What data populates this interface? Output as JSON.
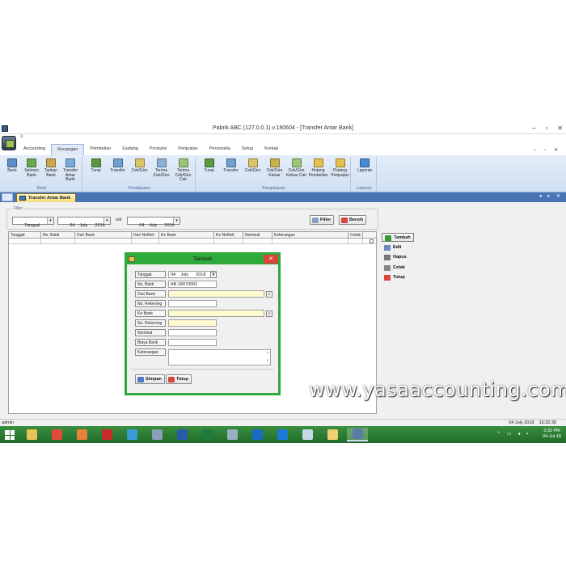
{
  "window": {
    "title": "Pabrik ABC (127.0.0.1) v.180604 - [Transfer Antar  Bank]",
    "min": "–",
    "max": "▫",
    "close": "✕"
  },
  "ribbon": {
    "qat": "≡",
    "tabs": [
      "Accounting",
      "Keuangan",
      "Pembelian",
      "Gudang",
      "Produksi",
      "Penjualan",
      "Personalia",
      "Setup",
      "Kontak"
    ],
    "active_tab": "Keuangan",
    "mini_controls": "– ▫ ✕",
    "groups": [
      {
        "name": "Bank",
        "buttons": [
          {
            "label": "Bank",
            "icon": "bank-icon",
            "color": "#5c8fc9"
          },
          {
            "label": "Setoran Bank",
            "icon": "deposit-icon",
            "color": "#6aa84f"
          },
          {
            "label": "Tarikan Bank",
            "icon": "withdraw-icon",
            "color": "#c9a94b"
          },
          {
            "label": "Transfer Antar Bank",
            "icon": "transfer-icon",
            "color": "#7aa8d8"
          }
        ]
      },
      {
        "name": "Pendapatan",
        "buttons": [
          {
            "label": "Tunai",
            "icon": "cash-icon",
            "color": "#5a9a40"
          },
          {
            "label": "Transfer",
            "icon": "transfer-income-icon",
            "color": "#6fa0d0"
          },
          {
            "label": "Cek/Giro",
            "icon": "cheque-icon",
            "color": "#d9c46a"
          },
          {
            "label": "Terima Cek/Giro",
            "icon": "receive-cheque-icon",
            "color": "#8ab0d8"
          },
          {
            "label": "Terima Cek/Giro Cair",
            "icon": "cheque-cleared-icon",
            "color": "#9bc37a"
          }
        ]
      },
      {
        "name": "Pengeluaran",
        "buttons": [
          {
            "label": "Tunai",
            "icon": "cash-out-icon",
            "color": "#5a9a40"
          },
          {
            "label": "Transfer",
            "icon": "transfer-out-icon",
            "color": "#6fa0d0"
          },
          {
            "label": "Cek/Giro",
            "icon": "cheque-out-icon",
            "color": "#d9c46a"
          },
          {
            "label": "Cek/Giro Keluar",
            "icon": "cheque-issued-icon",
            "color": "#c8b24a"
          },
          {
            "label": "Cek/Giro Keluar Cair",
            "icon": "cheque-issued-cleared-icon",
            "color": "#9bc37a"
          },
          {
            "label": "Hutang Pembelian",
            "icon": "payable-icon",
            "color": "#e6c04a"
          },
          {
            "label": "Piutang Penjualan",
            "icon": "receivable-icon",
            "color": "#e6c04a"
          }
        ]
      },
      {
        "name": "Laporan",
        "buttons": [
          {
            "label": "Laporan",
            "icon": "report-icon",
            "color": "#4a8ad0"
          }
        ]
      }
    ]
  },
  "doc_tab": {
    "label": "Transfer Antar  Bank"
  },
  "doc_controls": "◂ ▸ ✕",
  "filter": {
    "legend": "Filter",
    "field": "Tanggal",
    "date_from": "04    July      2018",
    "sd": "s/d",
    "date_to": "04    July      2018",
    "filter_btn": "Filter",
    "bersih_btn": "Bersih"
  },
  "grid": {
    "columns": [
      "Tanggal",
      "No. Bukti",
      "Dari Bank",
      "Dari NoRek",
      "Ke Bank",
      "Ke NoRek",
      "Nominal",
      "Keterangan",
      "Cetak"
    ]
  },
  "side_buttons": [
    {
      "label": "Tambah",
      "icon": "add-icon",
      "color": "#3a9a3a"
    },
    {
      "label": "Edit",
      "icon": "edit-icon",
      "color": "#6a8ac0"
    },
    {
      "label": "Hapus",
      "icon": "delete-icon",
      "color": "#777777"
    },
    {
      "label": "Cetak",
      "icon": "print-icon",
      "color": "#888888"
    },
    {
      "label": "Tutup",
      "icon": "close-icon",
      "color": "#d9453a"
    }
  ],
  "dialog": {
    "title": "Tambah",
    "close": "✕",
    "fields": [
      {
        "label": "Tanggal",
        "value": "04    July      2018"
      },
      {
        "label": "No. Bukti",
        "value": "AB.18070001"
      },
      {
        "label": "Dari Bank",
        "value": ""
      },
      {
        "label": "No. Rekening",
        "value": ""
      },
      {
        "label": "Ke Bank",
        "value": ""
      },
      {
        "label": "No. Rekening",
        "value": ""
      },
      {
        "label": "Nominal",
        "value": ""
      },
      {
        "label": "Biaya Bank",
        "value": ""
      },
      {
        "label": "Keterangan",
        "value": ""
      }
    ],
    "save_btn": "Simpan",
    "close_btn": "Tutup"
  },
  "watermark": "www.yasaaccounting.com",
  "status": {
    "user": "admin",
    "datetime": "04 July 2018    15:32:38"
  },
  "taskbar": {
    "apps": [
      {
        "name": "file-explorer-icon",
        "color": "#e8c25a"
      },
      {
        "name": "chrome-icon",
        "color": "#e04a3a"
      },
      {
        "name": "firefox-icon",
        "color": "#e8823a"
      },
      {
        "name": "opera-icon",
        "color": "#c82a2a"
      },
      {
        "name": "telegram-icon",
        "color": "#3a9ad8"
      },
      {
        "name": "settings-app-icon",
        "color": "#8aa0b8"
      },
      {
        "name": "word-icon",
        "color": "#2b5aa8"
      },
      {
        "name": "excel-icon",
        "color": "#1f7a40"
      },
      {
        "name": "tool-icon",
        "color": "#9ab0c0"
      },
      {
        "name": "outlook-icon",
        "color": "#1a6ac8"
      },
      {
        "name": "teamviewer-icon",
        "color": "#1a7ad8"
      },
      {
        "name": "notepad-icon",
        "color": "#c8d8e8"
      },
      {
        "name": "folder-icon",
        "color": "#f0d070"
      },
      {
        "name": "accounting-app-icon",
        "color": "#5a7aa8"
      }
    ],
    "tray": "⌃ ▭ ◂ ▪",
    "time": "3:32 PM",
    "date": "04-Jul-18"
  }
}
